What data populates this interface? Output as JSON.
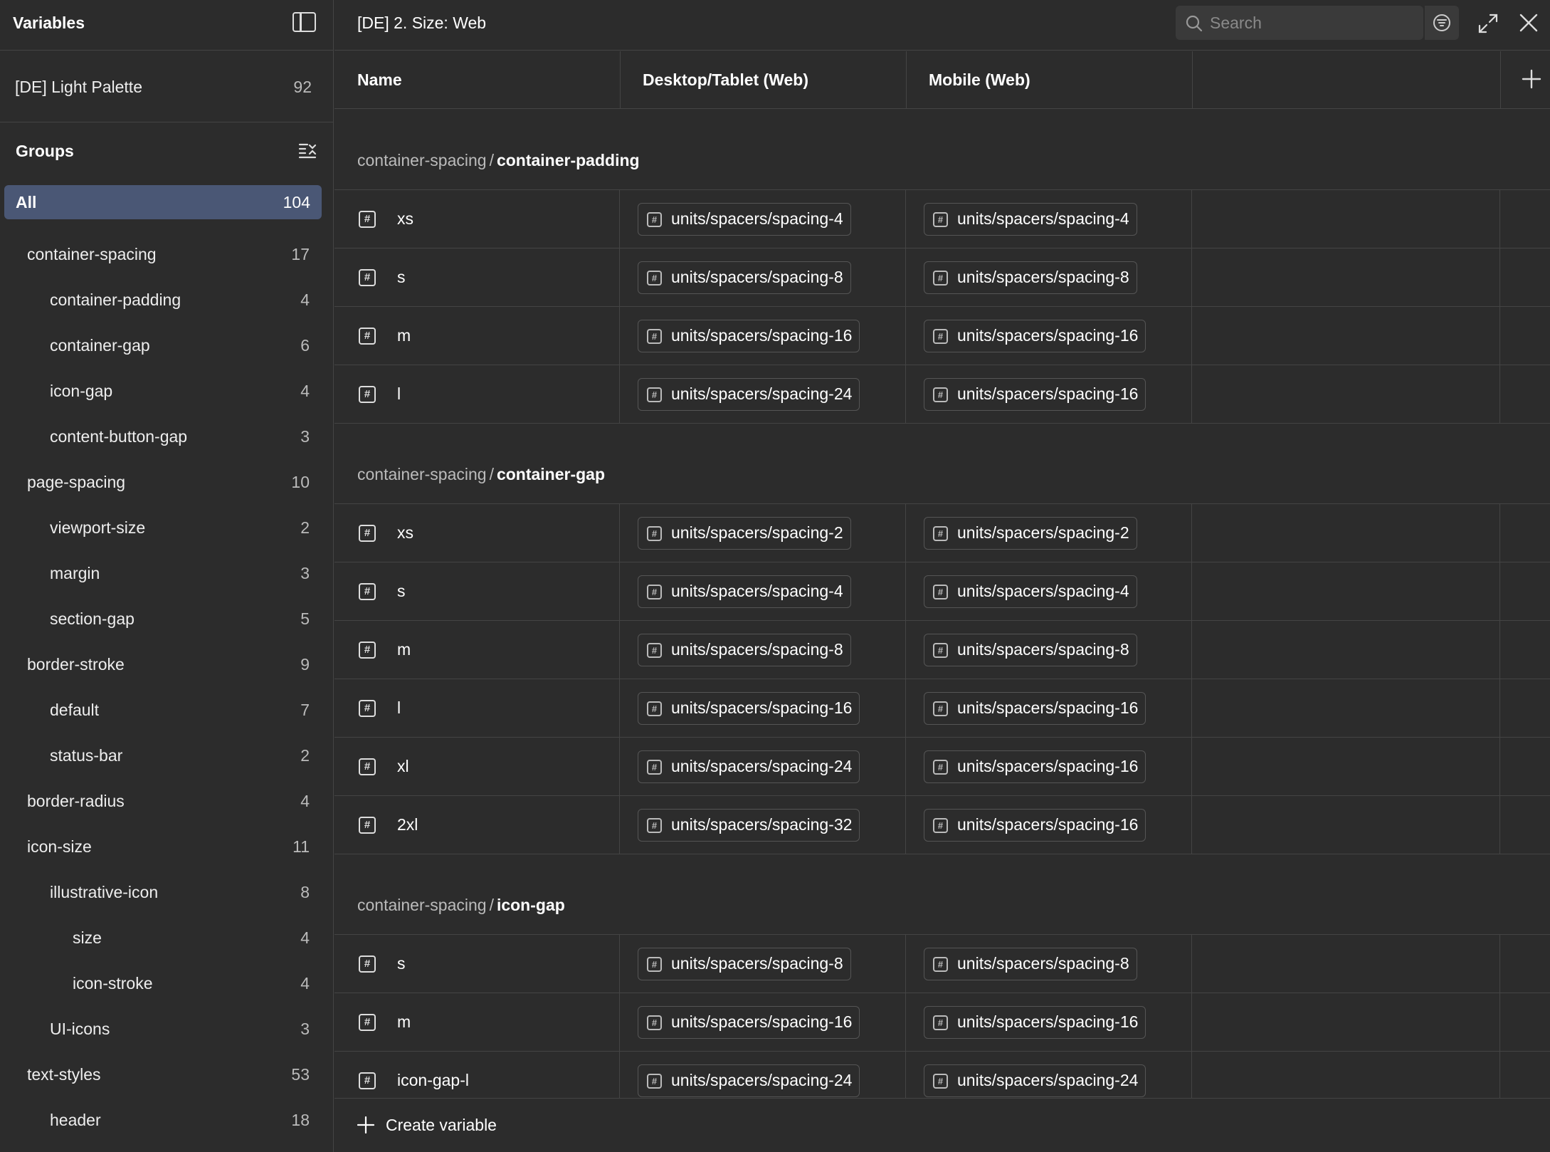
{
  "sidebar": {
    "title": "Variables",
    "collection": {
      "label": "[DE] Light Palette",
      "count": "92"
    },
    "groups_label": "Groups",
    "items": [
      {
        "label": "All",
        "count": "104",
        "level": 0,
        "selected": true
      },
      {
        "label": "container-spacing",
        "count": "17",
        "level": 1
      },
      {
        "label": "container-padding",
        "count": "4",
        "level": 2
      },
      {
        "label": "container-gap",
        "count": "6",
        "level": 2
      },
      {
        "label": "icon-gap",
        "count": "4",
        "level": 2
      },
      {
        "label": "content-button-gap",
        "count": "3",
        "level": 2
      },
      {
        "label": "page-spacing",
        "count": "10",
        "level": 1
      },
      {
        "label": "viewport-size",
        "count": "2",
        "level": 2
      },
      {
        "label": "margin",
        "count": "3",
        "level": 2
      },
      {
        "label": "section-gap",
        "count": "5",
        "level": 2
      },
      {
        "label": "border-stroke",
        "count": "9",
        "level": 1
      },
      {
        "label": "default",
        "count": "7",
        "level": 2
      },
      {
        "label": "status-bar",
        "count": "2",
        "level": 2
      },
      {
        "label": "border-radius",
        "count": "4",
        "level": 1
      },
      {
        "label": "icon-size",
        "count": "11",
        "level": 1
      },
      {
        "label": "illustrative-icon",
        "count": "8",
        "level": 2
      },
      {
        "label": "size",
        "count": "4",
        "level": 3
      },
      {
        "label": "icon-stroke",
        "count": "4",
        "level": 3
      },
      {
        "label": "UI-icons",
        "count": "3",
        "level": 2
      },
      {
        "label": "text-styles",
        "count": "53",
        "level": 1
      },
      {
        "label": "header",
        "count": "18",
        "level": 2
      }
    ]
  },
  "header": {
    "title": "[DE] 2. Size: Web",
    "search_placeholder": "Search"
  },
  "columns": {
    "name": "Name",
    "desktop": "Desktop/Tablet (Web)",
    "mobile": "Mobile (Web)"
  },
  "groups": [
    {
      "parent": "container-spacing",
      "separator": "/",
      "name": "container-padding",
      "rows": [
        {
          "name": "xs",
          "desktop": "units/spacers/spacing-4",
          "mobile": "units/spacers/spacing-4"
        },
        {
          "name": "s",
          "desktop": "units/spacers/spacing-8",
          "mobile": "units/spacers/spacing-8"
        },
        {
          "name": "m",
          "desktop": "units/spacers/spacing-16",
          "mobile": "units/spacers/spacing-16"
        },
        {
          "name": "l",
          "desktop": "units/spacers/spacing-24",
          "mobile": "units/spacers/spacing-16"
        }
      ]
    },
    {
      "parent": "container-spacing",
      "separator": "/",
      "name": "container-gap",
      "rows": [
        {
          "name": "xs",
          "desktop": "units/spacers/spacing-2",
          "mobile": "units/spacers/spacing-2"
        },
        {
          "name": "s",
          "desktop": "units/spacers/spacing-4",
          "mobile": "units/spacers/spacing-4"
        },
        {
          "name": "m",
          "desktop": "units/spacers/spacing-8",
          "mobile": "units/spacers/spacing-8"
        },
        {
          "name": "l",
          "desktop": "units/spacers/spacing-16",
          "mobile": "units/spacers/spacing-16"
        },
        {
          "name": "xl",
          "desktop": "units/spacers/spacing-24",
          "mobile": "units/spacers/spacing-16"
        },
        {
          "name": "2xl",
          "desktop": "units/spacers/spacing-32",
          "mobile": "units/spacers/spacing-16"
        }
      ]
    },
    {
      "parent": "container-spacing",
      "separator": "/",
      "name": "icon-gap",
      "rows": [
        {
          "name": "s",
          "desktop": "units/spacers/spacing-8",
          "mobile": "units/spacers/spacing-8"
        },
        {
          "name": "m",
          "desktop": "units/spacers/spacing-16",
          "mobile": "units/spacers/spacing-16"
        },
        {
          "name": "icon-gap-l",
          "desktop": "units/spacers/spacing-24",
          "mobile": "units/spacers/spacing-24"
        }
      ]
    }
  ],
  "variable_icon_glyph": "#",
  "footer": {
    "create_label": "Create variable"
  },
  "icons": {
    "sidebar_toggle": "sidebar-toggle-icon",
    "groups_menu": "list-collapse-icon",
    "search": "search-icon",
    "filter": "filter-icon",
    "expand": "expand-icon",
    "close": "close-icon",
    "add_column": "plus-icon",
    "variable": "number-variable-icon"
  },
  "colors": {
    "background": "#2c2c2c",
    "border": "#444444",
    "selected": "#4a5775",
    "text": "#ffffff",
    "muted": "#bbbbbb"
  }
}
